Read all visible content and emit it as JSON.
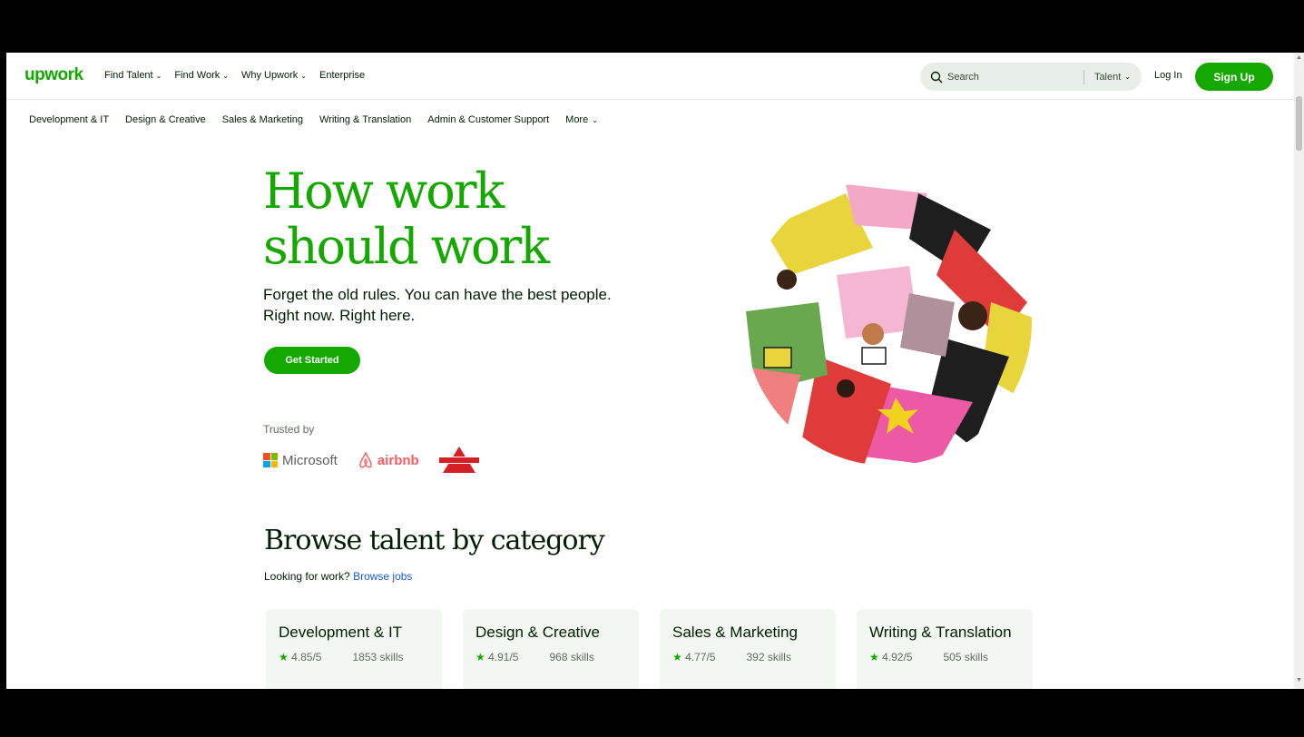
{
  "header": {
    "logo": "upwork",
    "nav": [
      "Find Talent",
      "Find Work",
      "Why Upwork",
      "Enterprise"
    ],
    "search_placeholder": "Search",
    "search_scope": "Talent",
    "login": "Log In",
    "signup": "Sign Up"
  },
  "categories_nav": [
    "Development & IT",
    "Design & Creative",
    "Sales & Marketing",
    "Writing & Translation",
    "Admin & Customer Support",
    "More"
  ],
  "hero": {
    "title_line1": "How work",
    "title_line2": "should work",
    "subtitle_line1": "Forget the old rules. You can have the best people.",
    "subtitle_line2": "Right now. Right here.",
    "cta": "Get Started",
    "trusted_by": "Trusted by",
    "logos": [
      "Microsoft",
      "airbnb",
      "BISSELL"
    ]
  },
  "browse": {
    "title": "Browse talent by category",
    "looking_text": "Looking for work?",
    "browse_jobs": "Browse jobs",
    "cards": [
      {
        "title": "Development & IT",
        "rating": "4.85/5",
        "skills": "1853 skills"
      },
      {
        "title": "Design & Creative",
        "rating": "4.91/5",
        "skills": "968 skills"
      },
      {
        "title": "Sales & Marketing",
        "rating": "4.77/5",
        "skills": "392 skills"
      },
      {
        "title": "Writing & Translation",
        "rating": "4.92/5",
        "skills": "505 skills"
      }
    ]
  },
  "colors": {
    "brand": "#14a800",
    "text": "#001e00",
    "link": "#1c5ad6"
  }
}
